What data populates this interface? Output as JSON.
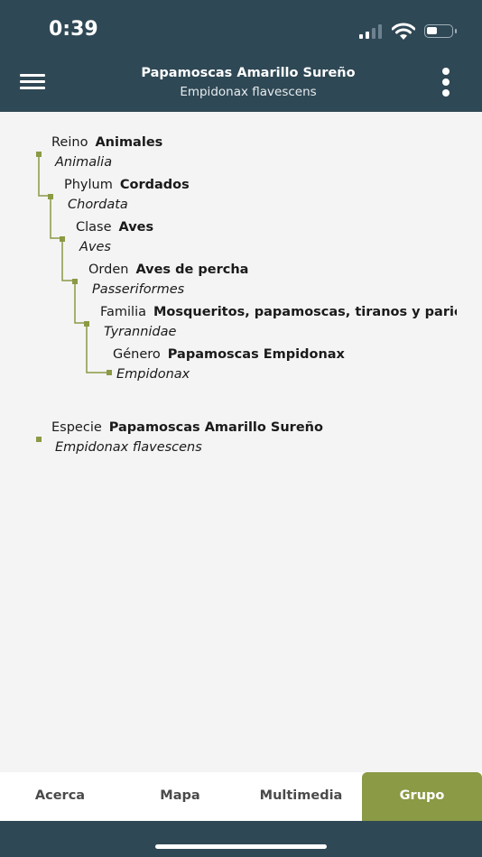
{
  "status_bar": {
    "time": "0:39"
  },
  "header": {
    "title": "Papamoscas Amarillo Sureño",
    "subtitle": "Empidonax flavescens"
  },
  "taxonomy": [
    {
      "rank": "Reino",
      "name": "Animales",
      "scientific": "Animalia"
    },
    {
      "rank": "Phylum",
      "name": "Cordados",
      "scientific": "Chordata"
    },
    {
      "rank": "Clase",
      "name": "Aves",
      "scientific": "Aves"
    },
    {
      "rank": "Orden",
      "name": "Aves de percha",
      "scientific": "Passeriformes"
    },
    {
      "rank": "Familia",
      "name": "Mosqueritos, papamoscas, tiranos y parientes",
      "scientific": "Tyrannidae"
    },
    {
      "rank": "Género",
      "name": "Papamoscas Empidonax",
      "scientific": "Empidonax"
    }
  ],
  "species": {
    "rank": "Especie",
    "name": "Papamoscas Amarillo Sureño",
    "scientific": "Empidonax flavescens"
  },
  "tabs": [
    "Acerca",
    "Mapa",
    "Multimedia",
    "Grupo"
  ],
  "active_tab": "Grupo",
  "colors": {
    "header_bg": "#2f4855",
    "accent": "#8a9a45",
    "tree_line": "#8a9a45"
  },
  "icons": {
    "menu": "hamburger-menu-icon",
    "more": "vertical-dots-icon"
  }
}
